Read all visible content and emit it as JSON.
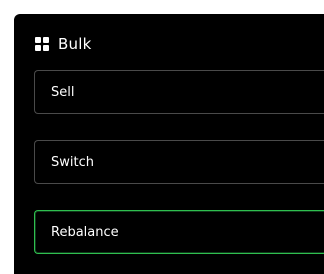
{
  "header": {
    "icon": "grid-icon",
    "title": "Bulk"
  },
  "options": [
    {
      "label": "Sell",
      "selected": false
    },
    {
      "label": "Switch",
      "selected": false
    },
    {
      "label": "Rebalance",
      "selected": true
    }
  ],
  "colors": {
    "panel_background": "#000000",
    "option_border": "#4a4a4a",
    "selected_border": "#2fbf4f",
    "text": "#ffffff"
  }
}
